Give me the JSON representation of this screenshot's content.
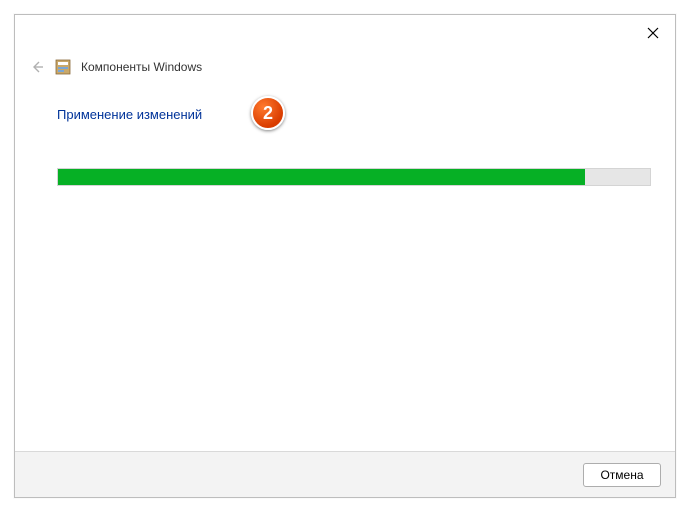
{
  "window": {
    "title": "Компоненты Windows"
  },
  "body": {
    "heading": "Применение изменений",
    "progress_percent": 89
  },
  "footer": {
    "cancel_label": "Отмена"
  },
  "annotation": {
    "badge": "2"
  }
}
